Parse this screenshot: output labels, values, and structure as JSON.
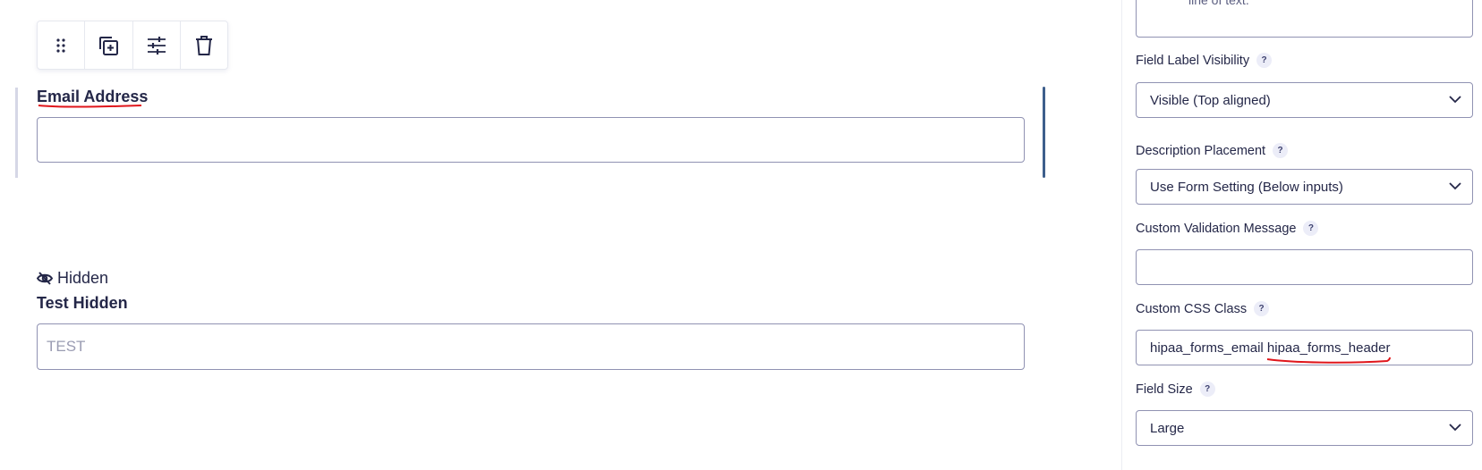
{
  "canvas": {
    "toolbar": {
      "icons": [
        "drag-handle-icon",
        "duplicate-icon",
        "settings-sliders-icon",
        "trash-icon"
      ]
    },
    "email_field": {
      "label": "Email Address",
      "value": ""
    },
    "hidden_field": {
      "badge": "Hidden",
      "label": "Test Hidden",
      "placeholder": "TEST"
    }
  },
  "sidebar": {
    "top_partial_text": "line of text.",
    "field_label_visibility": {
      "label": "Field Label Visibility",
      "help": "?",
      "value": "Visible (Top aligned)"
    },
    "description_placement": {
      "label": "Description Placement",
      "help": "?",
      "value": "Use Form Setting (Below inputs)"
    },
    "custom_validation_message": {
      "label": "Custom Validation Message",
      "help": "?",
      "value": ""
    },
    "custom_css_class": {
      "label": "Custom CSS Class",
      "help": "?",
      "value": "hipaa_forms_email hipaa_forms_header"
    },
    "field_size": {
      "label": "Field Size",
      "help": "?",
      "value": "Large"
    }
  },
  "colors": {
    "text": "#242748",
    "border": "#9092b2",
    "active_bar": "#3e5f8c",
    "annotation_red": "#e0161b",
    "help_bg": "#ecedf8"
  }
}
